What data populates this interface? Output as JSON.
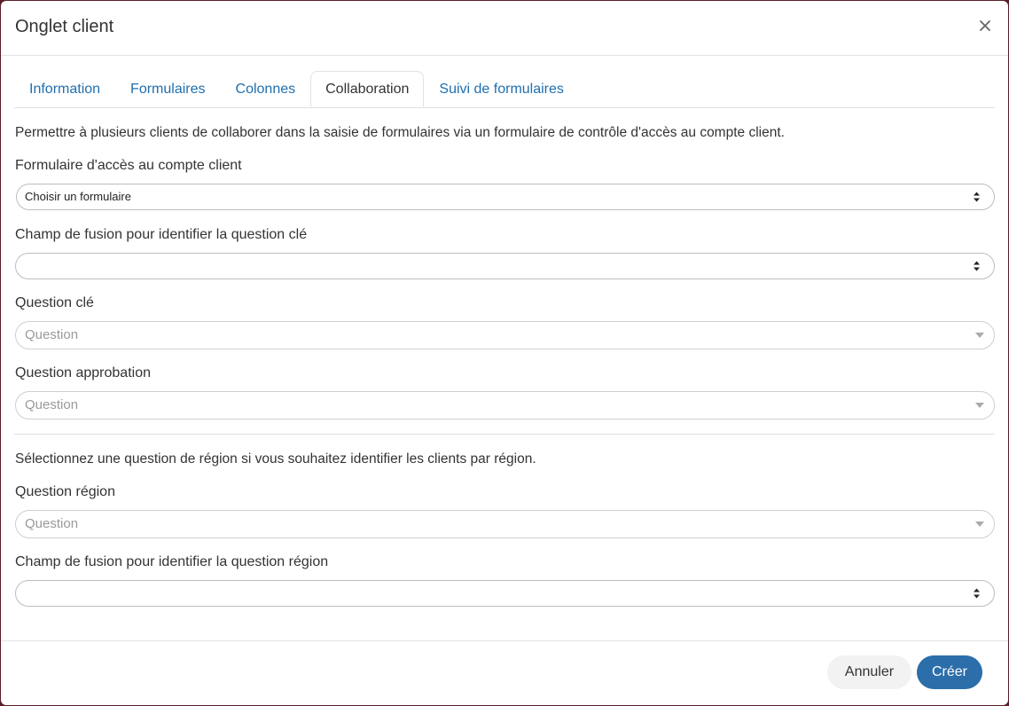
{
  "modal": {
    "title": "Onglet client"
  },
  "tabs": [
    {
      "label": "Information"
    },
    {
      "label": "Formulaires"
    },
    {
      "label": "Colonnes"
    },
    {
      "label": "Collaboration"
    },
    {
      "label": "Suivi de formulaires"
    }
  ],
  "active_tab": "Collaboration",
  "collaboration": {
    "intro": "Permettre à plusieurs clients de collaborer dans la saisie de formulaires via un formulaire de contrôle d'accès au compte client.",
    "access_form": {
      "label": "Formulaire d'accès au compte client",
      "value": "Choisir un formulaire"
    },
    "merge_field_key": {
      "label": "Champ de fusion pour identifier la question clé",
      "value": ""
    },
    "key_question": {
      "label": "Question clé",
      "placeholder": "Question"
    },
    "approval_question": {
      "label": "Question approbation",
      "placeholder": "Question"
    },
    "region_intro": "Sélectionnez une question de région si vous souhaitez identifier les clients par région.",
    "region_question": {
      "label": "Question région",
      "placeholder": "Question"
    },
    "merge_field_region": {
      "label": "Champ de fusion pour identifier la question région",
      "value": ""
    }
  },
  "footer": {
    "cancel_label": "Annuler",
    "create_label": "Créer"
  },
  "colors": {
    "link": "#1f6fb0",
    "primary_button": "#2b6ea9",
    "backdrop": "#5a1e2a"
  },
  "icons": {
    "close": "close-icon",
    "select_arrows": "select-updown-arrows-icon",
    "dropdown_caret": "caret-down-icon"
  }
}
